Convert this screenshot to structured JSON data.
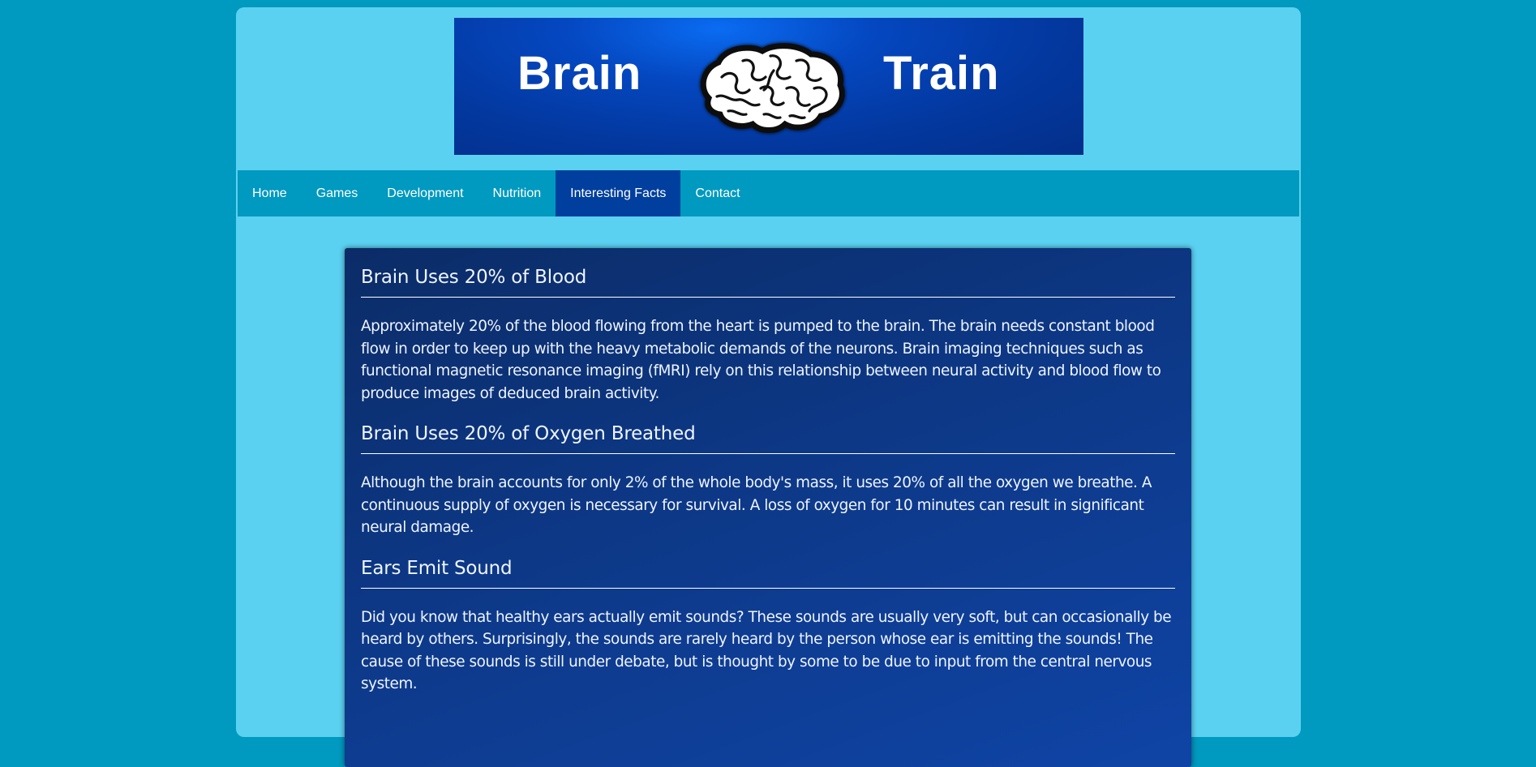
{
  "banner": {
    "left_word": "Brain",
    "right_word": "Train",
    "icon": "brain-icon",
    "colors": {
      "dark": "#032f8a",
      "light": "#0a6cf2"
    }
  },
  "nav": {
    "items": [
      {
        "label": "Home"
      },
      {
        "label": "Games"
      },
      {
        "label": "Development"
      },
      {
        "label": "Nutrition"
      },
      {
        "label": "Interesting Facts"
      },
      {
        "label": "Contact"
      }
    ],
    "active_index": 4
  },
  "facts": [
    {
      "title": "Brain Uses 20% of Blood",
      "body": "Approximately 20% of the blood flowing from the heart is pumped to the brain. The brain needs constant blood flow in order to keep up with the heavy metabolic demands of the neurons. Brain imaging techniques such as functional magnetic resonance imaging (fMRI) rely on this relationship between neural activity and blood flow to produce images of deduced brain activity."
    },
    {
      "title": "Brain Uses 20% of Oxygen Breathed",
      "body": "Although the brain accounts for only 2% of the whole body's mass, it uses 20% of all the oxygen we breathe. A continuous supply of oxygen is necessary for survival. A loss of oxygen for 10 minutes can result in significant neural damage."
    },
    {
      "title": "Ears Emit Sound",
      "body": "Did you know that healthy ears actually emit sounds? These sounds are usually very soft, but can occasionally be heard by others. Surprisingly, the sounds are rarely heard by the person whose ear is emitting the sounds! The cause of these sounds is still under debate, but is thought by some to be due to input from the central nervous system."
    }
  ],
  "colors": {
    "background": "#0099bf",
    "page": "#5bd1f1",
    "nav": "#0099bf",
    "nav_active": "#003f9e",
    "content": "#0d3886"
  }
}
